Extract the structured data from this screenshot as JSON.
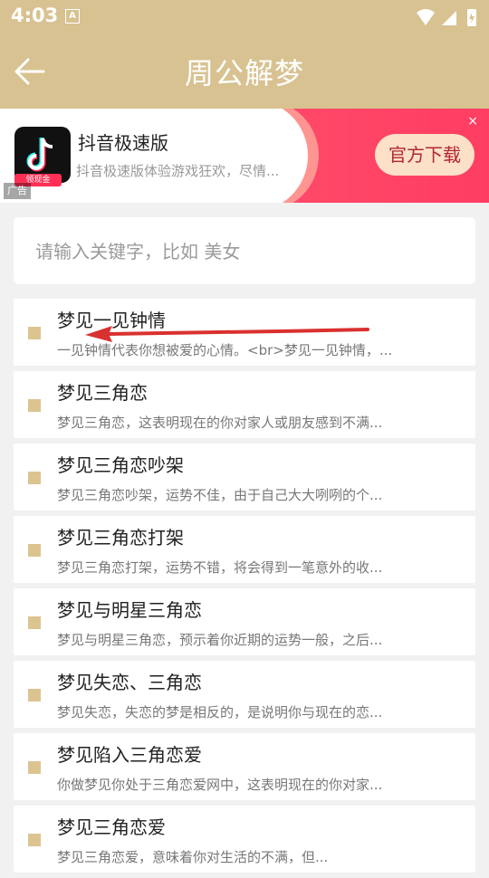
{
  "status_bar": {
    "time": "4:03",
    "a_icon": "A"
  },
  "header": {
    "title": "周公解梦"
  },
  "ad": {
    "app_name": "抖音极速版",
    "description": "抖音极速版体验游戏狂欢，尽情...",
    "cta": "官方下载",
    "badge": "领现金",
    "label": "广告",
    "close": "×"
  },
  "search": {
    "placeholder": "请输入关键字，比如 美女"
  },
  "results": [
    {
      "title": "梦见一见钟情",
      "summary": "一见钟情代表你想被爱的心情。<br>梦见一见钟情，..."
    },
    {
      "title": "梦见三角恋",
      "summary": "梦见三角恋，这表明现在的你对家人或朋友感到不满..."
    },
    {
      "title": "梦见三角恋吵架",
      "summary": "梦见三角恋吵架，运势不佳，由于自己大大咧咧的个..."
    },
    {
      "title": "梦见三角恋打架",
      "summary": "梦见三角恋打架，运势不错，将会得到一笔意外的收..."
    },
    {
      "title": "梦见与明星三角恋",
      "summary": "梦见与明星三角恋，预示着你近期的运势一般，之后..."
    },
    {
      "title": "梦见失恋、三角恋",
      "summary": "梦见失恋，失恋的梦是相反的，是说明你与现在的恋..."
    },
    {
      "title": "梦见陷入三角恋爱",
      "summary": "你做梦见你处于三角恋爱网中，这表明现在的你对家..."
    },
    {
      "title": "梦见三角恋爱",
      "summary": "梦见三角恋爱，意味着你对生活的不满，但..."
    }
  ],
  "colors": {
    "accent": "#d8c291",
    "ad_bg": "#ff4a68",
    "annotation_arrow": "#d9312f"
  }
}
